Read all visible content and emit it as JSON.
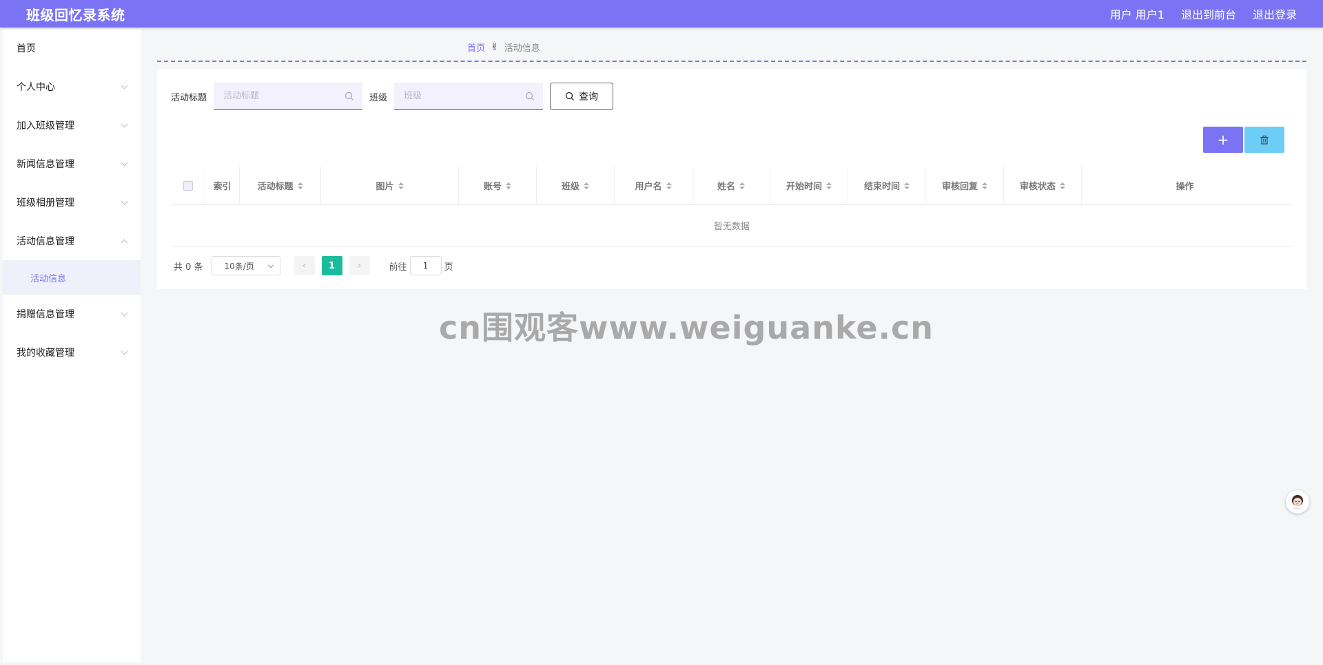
{
  "header": {
    "title": "班级回忆录系统",
    "user_label": "用户 用户1",
    "front_link": "退出到前台",
    "logout_link": "退出登录"
  },
  "sidebar": {
    "items": [
      {
        "label": "首页"
      },
      {
        "label": "个人中心"
      },
      {
        "label": "加入班级管理"
      },
      {
        "label": "新闻信息管理"
      },
      {
        "label": "班级相册管理"
      },
      {
        "label": "活动信息管理"
      },
      {
        "label": "捐赠信息管理"
      },
      {
        "label": "我的收藏管理"
      }
    ],
    "sub_active": "活动信息"
  },
  "breadcrumb": {
    "home": "首页",
    "separator": "✌",
    "current": "活动信息"
  },
  "search": {
    "title_label": "活动标题",
    "title_placeholder": "活动标题",
    "class_label": "班级",
    "class_placeholder": "班级",
    "query_button": "查询"
  },
  "toolbar": {
    "add_label": "+"
  },
  "table": {
    "columns": [
      "索引",
      "活动标题",
      "图片",
      "账号",
      "班级",
      "用户名",
      "姓名",
      "开始时间",
      "结束时间",
      "审核回复",
      "审核状态",
      "操作"
    ],
    "empty_text": "暂无数据"
  },
  "pagination": {
    "total": "共 0 条",
    "page_size": "10条/页",
    "current_page": "1",
    "goto_prefix": "前往",
    "goto_value": "1",
    "goto_suffix": "页"
  },
  "watermark": "cn围观客www.weiguanke.cn",
  "colors": {
    "accent": "#7a74f4",
    "info": "#6ccdf7",
    "page_active": "#1abc9c"
  }
}
